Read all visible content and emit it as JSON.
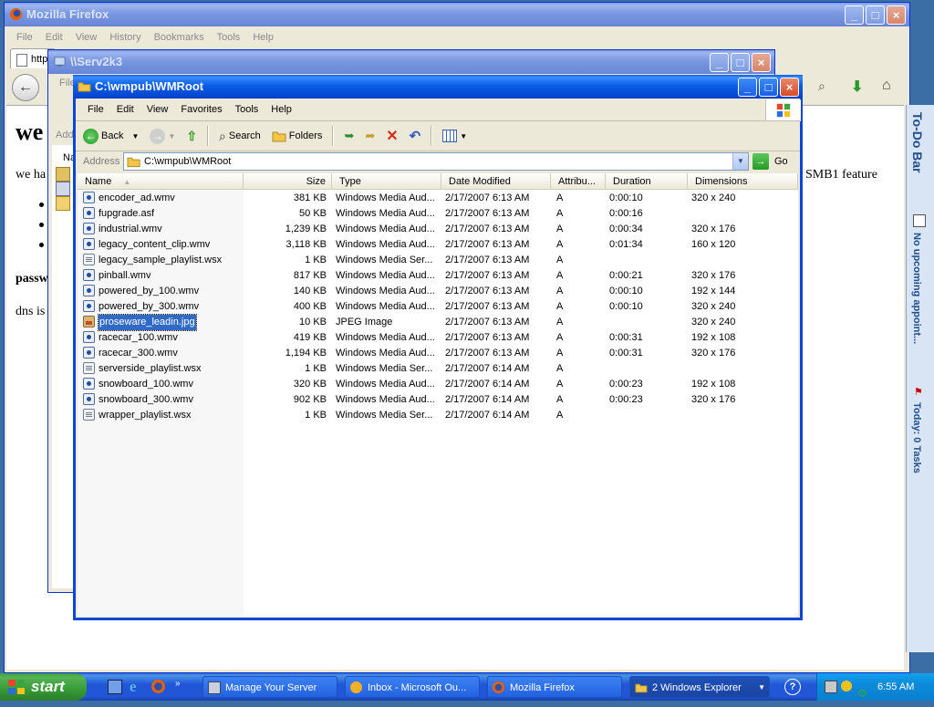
{
  "firefox": {
    "title": "Mozilla Firefox",
    "menu": [
      "File",
      "Edit",
      "View",
      "History",
      "Bookmarks",
      "Tools",
      "Help"
    ],
    "tab_fragment": "http",
    "sidebar_title": "To-Do Bar",
    "sidebar_appointments": "No upcoming appoint...",
    "sidebar_tasks": "Today: 0 Tasks",
    "page_heading_fragment": "we",
    "page_text_fragment": "we ha",
    "page_text_right": "SMB1 feature",
    "page_bold_fragment": "passw",
    "page_dns_fragment": "dns is"
  },
  "serv_window": {
    "title": "\\\\Serv2k3",
    "menu_fragment": "File",
    "address_fragment": "Add",
    "na_fragment": "Na"
  },
  "explorer": {
    "title": "C:\\wmpub\\WMRoot",
    "menu": [
      "File",
      "Edit",
      "View",
      "Favorites",
      "Tools",
      "Help"
    ],
    "toolbar": {
      "back": "Back",
      "search": "Search",
      "folders": "Folders"
    },
    "address": {
      "label": "Address",
      "value": "C:\\wmpub\\WMRoot",
      "go": "Go"
    },
    "columns": [
      "Name",
      "Size",
      "Type",
      "Date Modified",
      "Attribu...",
      "Duration",
      "Dimensions"
    ],
    "files": [
      {
        "name": "encoder_ad.wmv",
        "size": "381 KB",
        "type": "Windows Media Aud...",
        "date": "2/17/2007 6:13 AM",
        "attr": "A",
        "duration": "0:00:10",
        "dims": "320 x 240",
        "icon": "wmv"
      },
      {
        "name": "fupgrade.asf",
        "size": "50 KB",
        "type": "Windows Media Aud...",
        "date": "2/17/2007 6:13 AM",
        "attr": "A",
        "duration": "0:00:16",
        "dims": "",
        "icon": "wmv"
      },
      {
        "name": "industrial.wmv",
        "size": "1,239 KB",
        "type": "Windows Media Aud...",
        "date": "2/17/2007 6:13 AM",
        "attr": "A",
        "duration": "0:00:34",
        "dims": "320 x 176",
        "icon": "wmv"
      },
      {
        "name": "legacy_content_clip.wmv",
        "size": "3,118 KB",
        "type": "Windows Media Aud...",
        "date": "2/17/2007 6:13 AM",
        "attr": "A",
        "duration": "0:01:34",
        "dims": "160 x 120",
        "icon": "wmv"
      },
      {
        "name": "legacy_sample_playlist.wsx",
        "size": "1 KB",
        "type": "Windows Media Ser...",
        "date": "2/17/2007 6:13 AM",
        "attr": "A",
        "duration": "",
        "dims": "",
        "icon": "wsx"
      },
      {
        "name": "pinball.wmv",
        "size": "817 KB",
        "type": "Windows Media Aud...",
        "date": "2/17/2007 6:13 AM",
        "attr": "A",
        "duration": "0:00:21",
        "dims": "320 x 176",
        "icon": "wmv"
      },
      {
        "name": "powered_by_100.wmv",
        "size": "140 KB",
        "type": "Windows Media Aud...",
        "date": "2/17/2007 6:13 AM",
        "attr": "A",
        "duration": "0:00:10",
        "dims": "192 x 144",
        "icon": "wmv"
      },
      {
        "name": "powered_by_300.wmv",
        "size": "400 KB",
        "type": "Windows Media Aud...",
        "date": "2/17/2007 6:13 AM",
        "attr": "A",
        "duration": "0:00:10",
        "dims": "320 x 240",
        "icon": "wmv"
      },
      {
        "name": "proseware_leadin.jpg",
        "size": "10 KB",
        "type": "JPEG Image",
        "date": "2/17/2007 6:13 AM",
        "attr": "A",
        "duration": "",
        "dims": "320 x 240",
        "icon": "jpg",
        "selected": true
      },
      {
        "name": "racecar_100.wmv",
        "size": "419 KB",
        "type": "Windows Media Aud...",
        "date": "2/17/2007 6:13 AM",
        "attr": "A",
        "duration": "0:00:31",
        "dims": "192 x 108",
        "icon": "wmv"
      },
      {
        "name": "racecar_300.wmv",
        "size": "1,194 KB",
        "type": "Windows Media Aud...",
        "date": "2/17/2007 6:13 AM",
        "attr": "A",
        "duration": "0:00:31",
        "dims": "320 x 176",
        "icon": "wmv"
      },
      {
        "name": "serverside_playlist.wsx",
        "size": "1 KB",
        "type": "Windows Media Ser...",
        "date": "2/17/2007 6:14 AM",
        "attr": "A",
        "duration": "",
        "dims": "",
        "icon": "wsx"
      },
      {
        "name": "snowboard_100.wmv",
        "size": "320 KB",
        "type": "Windows Media Aud...",
        "date": "2/17/2007 6:14 AM",
        "attr": "A",
        "duration": "0:00:23",
        "dims": "192 x 108",
        "icon": "wmv"
      },
      {
        "name": "snowboard_300.wmv",
        "size": "902 KB",
        "type": "Windows Media Aud...",
        "date": "2/17/2007 6:14 AM",
        "attr": "A",
        "duration": "0:00:23",
        "dims": "320 x 176",
        "icon": "wmv"
      },
      {
        "name": "wrapper_playlist.wsx",
        "size": "1 KB",
        "type": "Windows Media Ser...",
        "date": "2/17/2007 6:14 AM",
        "attr": "A",
        "duration": "",
        "dims": "",
        "icon": "wsx"
      }
    ]
  },
  "taskbar": {
    "start": "start",
    "buttons": [
      {
        "label": "Manage Your Server"
      },
      {
        "label": "Inbox - Microsoft Ou..."
      },
      {
        "label": "Mozilla Firefox"
      },
      {
        "label": "2 Windows Explorer"
      }
    ],
    "clock": "6:55 AM"
  },
  "colors": {
    "xp_blue": "#0a5ee6",
    "selection": "#316ac5",
    "start_green": "#3c9e3c"
  }
}
